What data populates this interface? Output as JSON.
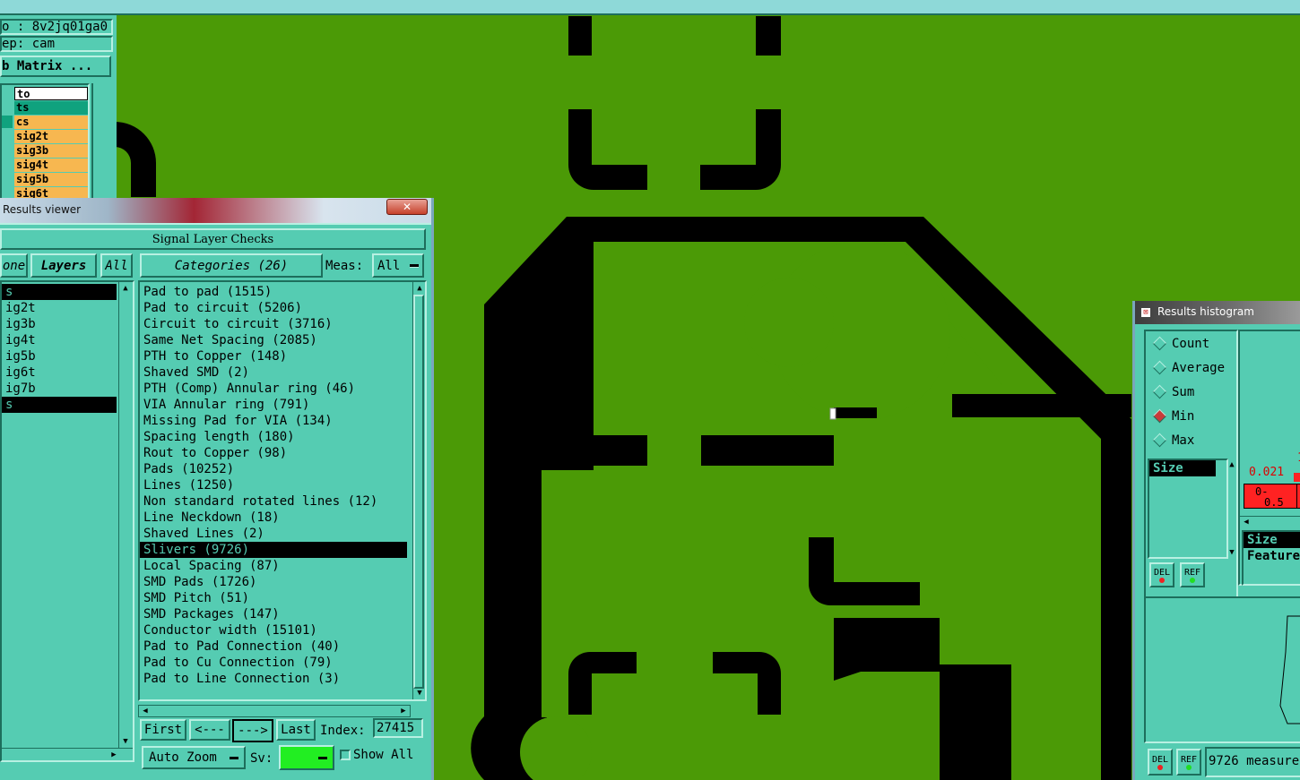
{
  "top_panel": {
    "job_line": "o : 8v2jq01ga0",
    "step_line": "ep: cam",
    "matrix_button": "b Matrix ..."
  },
  "layers_bg": [
    {
      "name": "to",
      "color": "#ffffff"
    },
    {
      "name": "ts",
      "color": "#10a27e"
    },
    {
      "name": "cs",
      "color": "#f7b750"
    },
    {
      "name": "sig2t",
      "color": "#f7b750"
    },
    {
      "name": "sig3b",
      "color": "#f7b750"
    },
    {
      "name": "sig4t",
      "color": "#f7b750"
    },
    {
      "name": "sig5b",
      "color": "#f7b750"
    },
    {
      "name": "sig6t",
      "color": "#f7b750"
    }
  ],
  "results_viewer": {
    "title": "Results viewer",
    "close_glyph": "✕",
    "header": "Signal Layer Checks",
    "left_tab_none": "one",
    "layers_button": "Layers",
    "all_button": "All",
    "categories_button": "Categories (26)",
    "meas_label": "Meas:",
    "meas_value": "All",
    "layer_items": [
      {
        "label": "s",
        "selected": true
      },
      {
        "label": "ig2t",
        "selected": false
      },
      {
        "label": "ig3b",
        "selected": false
      },
      {
        "label": "ig4t",
        "selected": false
      },
      {
        "label": "ig5b",
        "selected": false
      },
      {
        "label": "ig6t",
        "selected": false
      },
      {
        "label": "ig7b",
        "selected": false
      },
      {
        "label": "s",
        "selected": true
      }
    ],
    "categories": [
      {
        "label": "Pad to pad (1515)",
        "selected": false
      },
      {
        "label": "Pad to circuit (5206)",
        "selected": false
      },
      {
        "label": "Circuit to circuit (3716)",
        "selected": false
      },
      {
        "label": "Same Net Spacing (2085)",
        "selected": false
      },
      {
        "label": "PTH to Copper (148)",
        "selected": false
      },
      {
        "label": "Shaved SMD (2)",
        "selected": false
      },
      {
        "label": "PTH (Comp) Annular ring (46)",
        "selected": false
      },
      {
        "label": "VIA Annular ring (791)",
        "selected": false
      },
      {
        "label": "Missing Pad for VIA (134)",
        "selected": false
      },
      {
        "label": "Spacing length (180)",
        "selected": false
      },
      {
        "label": "Rout to Copper (98)",
        "selected": false
      },
      {
        "label": "Pads (10252)",
        "selected": false
      },
      {
        "label": "Lines (1250)",
        "selected": false
      },
      {
        "label": "Non standard rotated lines (12)",
        "selected": false
      },
      {
        "label": "Line Neckdown (18)",
        "selected": false
      },
      {
        "label": "Shaved Lines (2)",
        "selected": false
      },
      {
        "label": "Slivers (9726)",
        "selected": true
      },
      {
        "label": "Local Spacing (87)",
        "selected": false
      },
      {
        "label": "SMD Pads (1726)",
        "selected": false
      },
      {
        "label": "SMD Pitch (51)",
        "selected": false
      },
      {
        "label": "SMD Packages (147)",
        "selected": false
      },
      {
        "label": "Conductor width (15101)",
        "selected": false
      },
      {
        "label": "Pad to Pad Connection (40)",
        "selected": false
      },
      {
        "label": "Pad to Cu Connection (79)",
        "selected": false
      },
      {
        "label": "Pad to Line Connection (3)",
        "selected": false
      }
    ],
    "nav": {
      "first": "First",
      "prev": "<---",
      "next": "--->",
      "last": "Last",
      "index_label": "Index:",
      "index_value": "27415"
    },
    "auto_zoom": "Auto Zoom",
    "sv_label": "Sv:",
    "sv_color": "#22ee22",
    "show_all": "Show All"
  },
  "histogram": {
    "title": "Results histogram",
    "options": [
      {
        "label": "Count",
        "selected": false
      },
      {
        "label": "Average",
        "selected": false
      },
      {
        "label": "Sum",
        "selected": false
      },
      {
        "label": "Min",
        "selected": true
      },
      {
        "label": "Max",
        "selected": false
      }
    ],
    "size_item": "Size",
    "del_label": "DEL",
    "ref_label": "REF",
    "min_value": "0.021",
    "bin_top": "1",
    "bin_label_1": "0-",
    "bin_label_2": "0.5",
    "size_list": [
      "Size",
      "Feature"
    ],
    "status": "9726 measure"
  },
  "colors": {
    "copper": "#4b9a06",
    "panel": "#55ccb2",
    "bar": "#ff2222"
  }
}
